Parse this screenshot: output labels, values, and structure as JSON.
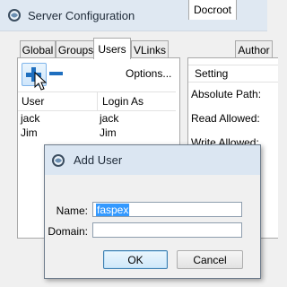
{
  "window": {
    "title": "Server Configuration",
    "icon": "aspera-globe-icon"
  },
  "left_tabs": [
    {
      "label": "Global"
    },
    {
      "label": "Groups"
    },
    {
      "label": "Users"
    },
    {
      "label": "VLinks"
    }
  ],
  "users_panel": {
    "add_icon": "plus-icon",
    "remove_icon": "minus-icon",
    "options_label": "Options...",
    "columns": [
      "User",
      "Login As"
    ],
    "rows": [
      {
        "user": "jack",
        "login_as": "jack"
      },
      {
        "user": "Jim",
        "login_as": "Jim"
      }
    ]
  },
  "right_tabs": [
    {
      "label": "Docroot"
    },
    {
      "label": "Author"
    }
  ],
  "settings_panel": {
    "header": "Setting",
    "properties": [
      "Absolute Path:",
      "Read Allowed:",
      "Write Allowed:"
    ]
  },
  "add_user_dialog": {
    "title": "Add User",
    "name_label": "Name:",
    "name_value": "faspex",
    "domain_label": "Domain:",
    "domain_value": "",
    "ok_label": "OK",
    "cancel_label": "Cancel"
  },
  "colors": {
    "selection": "#3399ff",
    "add_icon": "#1f6fbf"
  }
}
